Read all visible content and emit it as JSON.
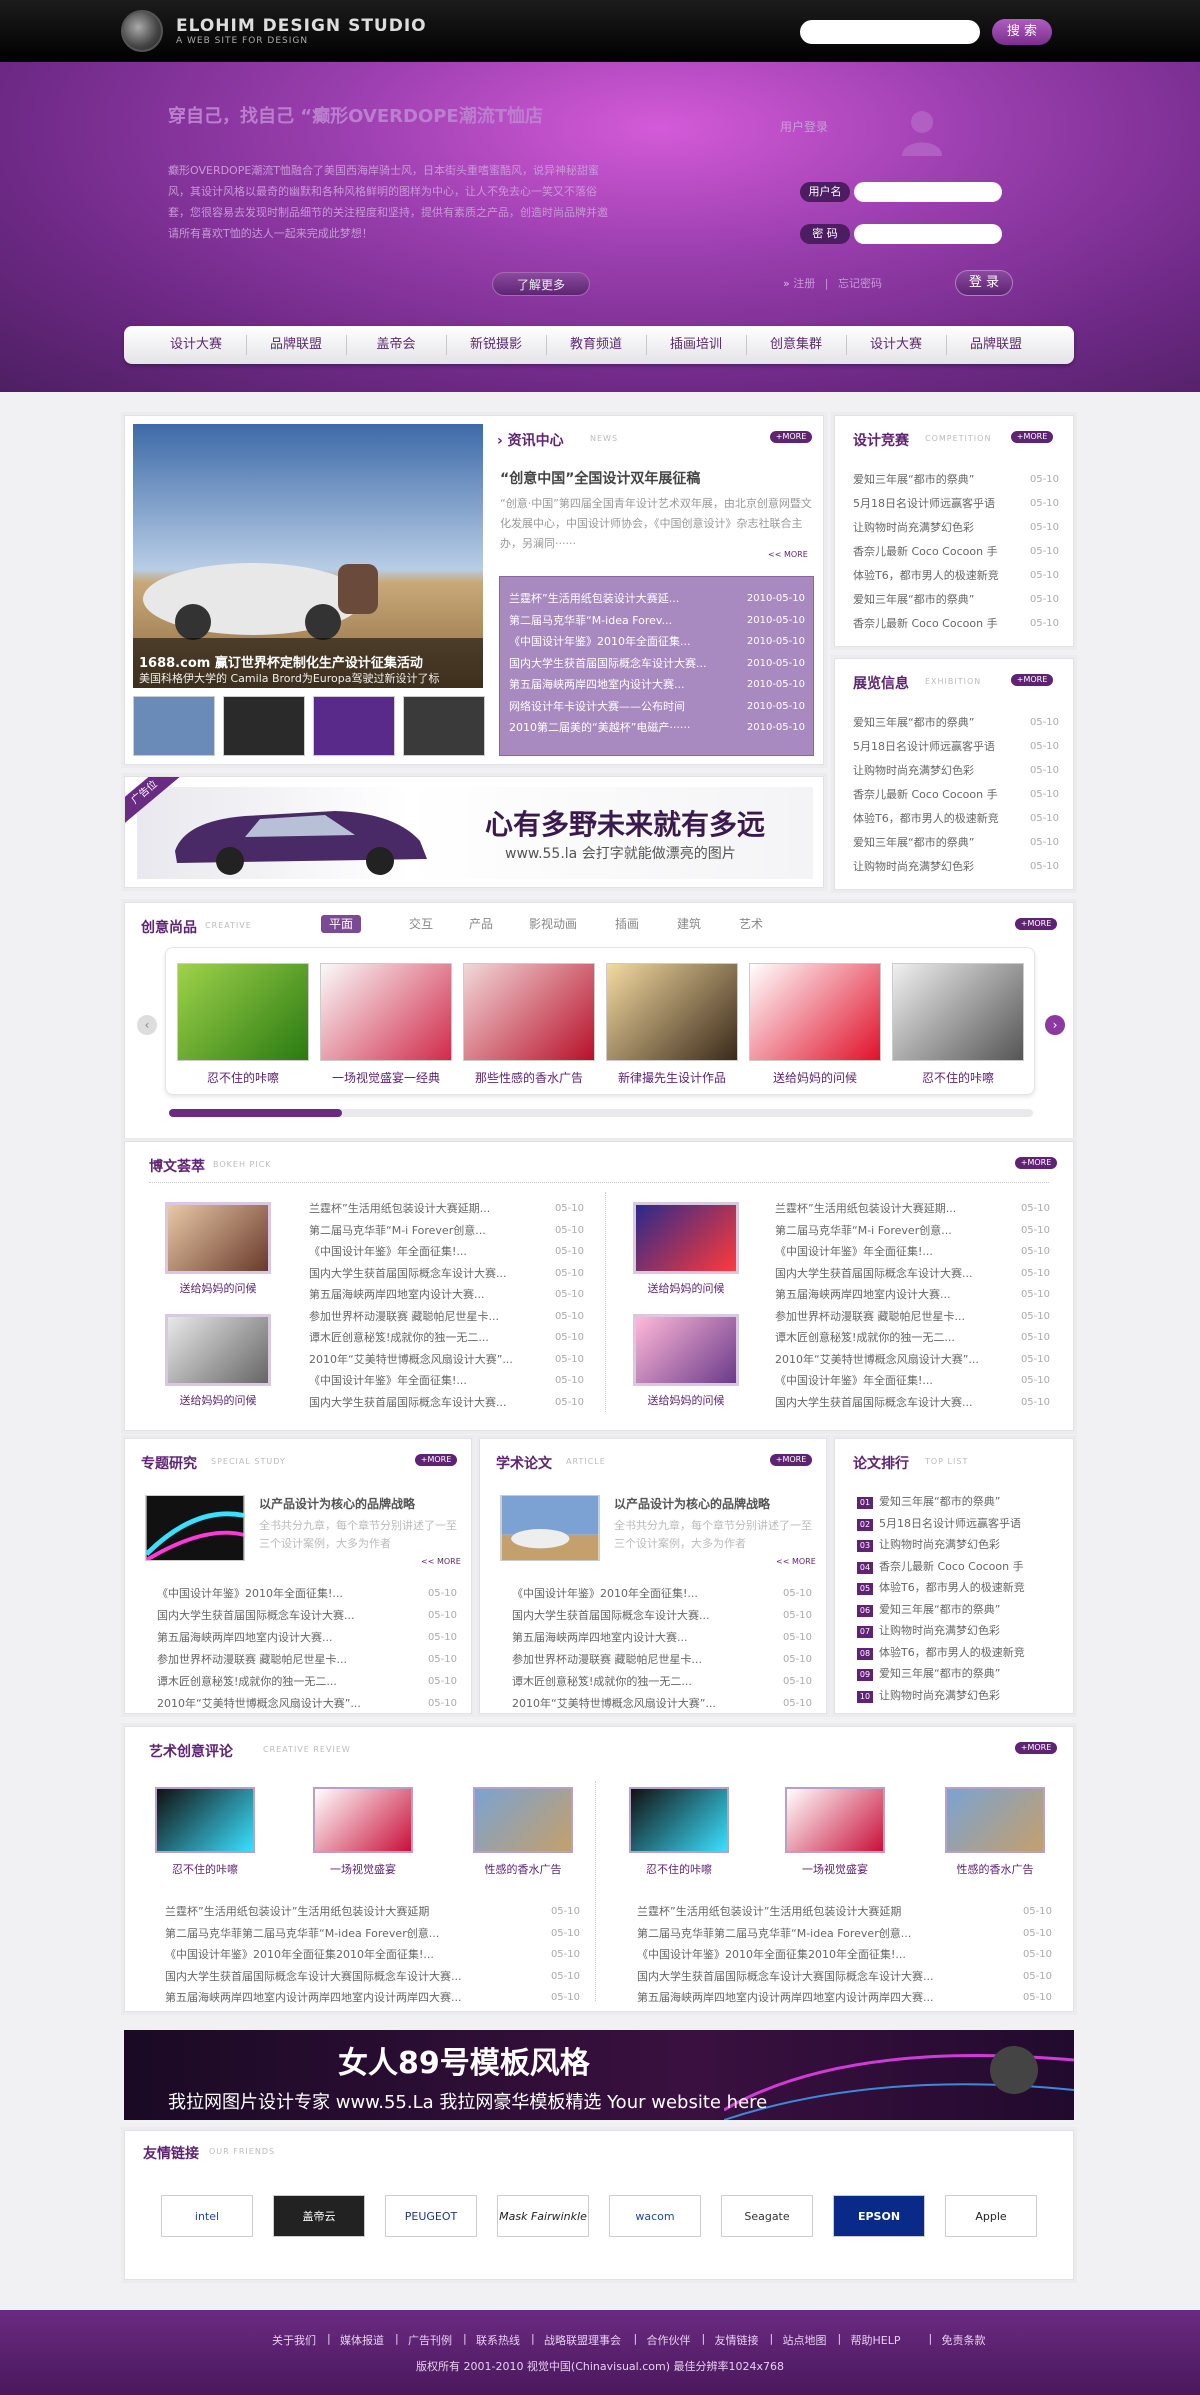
{
  "header": {
    "title": "ELOHIM DESIGN STUDIO",
    "subtitle": "A WEB SITE FOR DESIGN",
    "search_button": "搜 索"
  },
  "hero": {
    "title": "穿自己，找自己 “癫形OVERDOPE潮流T恤店",
    "desc": "癫形OVERDOPE潮流T恤融合了美国西海岸骑士风，日本街头重嗜蜜酷风，说异神秘甜蜜风，其设计风格以最奇的幽默和各种风格鲜明的图样为中心，让人不免去心一笑又不落俗套，您很容易去发现时制品细节的关注程度和坚持，提供有素质之产品，创造时尚品牌并邀请所有喜欢T恤的达人一起来完成此梦想！",
    "more": "了解更多"
  },
  "login": {
    "label": "用户登录",
    "username_tag": "用户名",
    "password_tag": "密  码",
    "register": "注册",
    "forgot": "忘记密码",
    "sep": "|",
    "button": "登 录"
  },
  "nav": [
    "设计大赛",
    "品牌联盟",
    "盖帝会",
    "新锐摄影",
    "教育频道",
    "插画培训",
    "创意集群",
    "设计大赛",
    "品牌联盟"
  ],
  "more_label": "+MORE",
  "news": {
    "title": "资讯中心",
    "sub": "NEWS",
    "headline": "“创意中国”全国设计双年展征稿",
    "summary": "“创意·中国”第四届全国青年设计艺术双年展，由北京创意网暨文化发展中心，中国设计师协会，《中国创意设计》杂志社联合主办，另澜同······",
    "summary_more": "<< MORE",
    "feature_caption1": "1688.com 赢订世界杯定制化生产设计征集活动",
    "feature_caption2": "美国科格伊大学的 Camila Brord为Europa驾驶过新设计了标",
    "items": [
      {
        "t": "兰霆杯”生活用纸包装设计大赛延...",
        "d": "2010-05-10"
      },
      {
        "t": "第二届马克华菲“M-idea Forev...",
        "d": "2010-05-10"
      },
      {
        "t": "《中国设计年鉴》2010年全面征集...",
        "d": "2010-05-10"
      },
      {
        "t": "国内大学生获首届国际概念车设计大赛...",
        "d": "2010-05-10"
      },
      {
        "t": "第五届海峡两岸四地室内设计大赛...",
        "d": "2010-05-10"
      },
      {
        "t": "网络设计年卡设计大赛——公布时间",
        "d": "2010-05-10"
      },
      {
        "t": "2010第二届美的“美越杯”电磁产······",
        "d": "2010-05-10"
      }
    ]
  },
  "contest": {
    "title": "设计竞赛",
    "sub": "COMPETITION",
    "items": [
      {
        "t": "爱知三年展“都市的祭典”",
        "d": "05-10"
      },
      {
        "t": "5月18日名设计师远赢客乎语",
        "d": "05-10"
      },
      {
        "t": "让购物时尚充满梦幻色彩",
        "d": "05-10"
      },
      {
        "t": "香奈儿最新 Coco Cocoon 手",
        "d": "05-10"
      },
      {
        "t": "体验T6，都市男人的极速新竞",
        "d": "05-10"
      },
      {
        "t": "爱知三年展“都市的祭典”",
        "d": "05-10"
      },
      {
        "t": "香奈儿最新 Coco Cocoon 手",
        "d": "05-10"
      }
    ]
  },
  "exhibit": {
    "title": "展览信息",
    "sub": "EXHIBITION",
    "items": [
      {
        "t": "爱知三年展“都市的祭典”",
        "d": "05-10"
      },
      {
        "t": "5月18日名设计师远赢客乎语",
        "d": "05-10"
      },
      {
        "t": "让购物时尚充满梦幻色彩",
        "d": "05-10"
      },
      {
        "t": "香奈儿最新 Coco Cocoon 手",
        "d": "05-10"
      },
      {
        "t": "体验T6，都市男人的极速新竞",
        "d": "05-10"
      },
      {
        "t": "爱知三年展“都市的祭典”",
        "d": "05-10"
      },
      {
        "t": "让购物时尚充满梦幻色彩",
        "d": "05-10"
      }
    ]
  },
  "ad1": {
    "tag": "广告位",
    "slogan": "心有多野未来就有多远",
    "sub": "www.55.la 会打字就能做漂亮的图片"
  },
  "creative": {
    "title": "创意尚品",
    "sub": "CREATIVE",
    "tabs": [
      "平面",
      "交互",
      "产品",
      "影视动画",
      "插画",
      "建筑",
      "艺术"
    ],
    "items": [
      "忍不住的咔嚓",
      "一场视觉盛宴一经典",
      "那些性感的香水广告",
      "新律撮先生设计作品",
      "送给妈妈的问候",
      "忍不住的咔嚓"
    ]
  },
  "blog": {
    "title": "博文荟萃",
    "sub": "BOKEH PICK",
    "caps": [
      "送给妈妈的问候",
      "送给妈妈的问候",
      "送给妈妈的问候",
      "送给妈妈的问候"
    ],
    "items": [
      {
        "t": "兰霆杯”生活用纸包装设计大赛延期...",
        "d": "05-10"
      },
      {
        "t": "第二届马克华菲“M-i Forever创意...",
        "d": "05-10"
      },
      {
        "t": "《中国设计年鉴》年全面征集!...",
        "d": "05-10"
      },
      {
        "t": "国内大学生获首届国际概念车设计大赛...",
        "d": "05-10"
      },
      {
        "t": "第五届海峡两岸四地室内设计大赛...",
        "d": "05-10"
      },
      {
        "t": "参加世界杯动漫联赛 藏聪帕尼世星卡...",
        "d": "05-10"
      },
      {
        "t": "谭木匠创意秘笈!成就你的独一无二...",
        "d": "05-10"
      },
      {
        "t": "2010年“艾美特世博概念风扇设计大赛”...",
        "d": "05-10"
      },
      {
        "t": "《中国设计年鉴》年全面征集!...",
        "d": "05-10"
      },
      {
        "t": "国内大学生获首届国际概念车设计大赛...",
        "d": "05-10"
      }
    ]
  },
  "special": {
    "title": "专题研究",
    "sub": "SPECIAL STUDY",
    "headline": "以产品设计为核心的品牌战略",
    "summary": "全书共分九章，每个章节分别讲述了一至三个设计案例，大多为作者",
    "more": "<< MORE",
    "items": [
      {
        "t": "《中国设计年鉴》2010年全面征集!...",
        "d": "05-10"
      },
      {
        "t": "国内大学生获首届国际概念车设计大赛...",
        "d": "05-10"
      },
      {
        "t": "第五届海峡两岸四地室内设计大赛...",
        "d": "05-10"
      },
      {
        "t": "参加世界杯动漫联赛 藏聪帕尼世星卡...",
        "d": "05-10"
      },
      {
        "t": "谭木匠创意秘笈!成就你的独一无二...",
        "d": "05-10"
      },
      {
        "t": "2010年“艾美特世博概念风扇设计大赛”...",
        "d": "05-10"
      }
    ]
  },
  "article": {
    "title": "学术论文",
    "sub": "ARTICLE",
    "headline": "以产品设计为核心的品牌战略",
    "summary": "全书共分九章，每个章节分别讲述了一至三个设计案例，大多为作者",
    "more": "<< MORE",
    "items": [
      {
        "t": "《中国设计年鉴》2010年全面征集!...",
        "d": "05-10"
      },
      {
        "t": "国内大学生获首届国际概念车设计大赛...",
        "d": "05-10"
      },
      {
        "t": "第五届海峡两岸四地室内设计大赛...",
        "d": "05-10"
      },
      {
        "t": "参加世界杯动漫联赛 藏聪帕尼世星卡...",
        "d": "05-10"
      },
      {
        "t": "谭木匠创意秘笈!成就你的独一无二...",
        "d": "05-10"
      },
      {
        "t": "2010年“艾美特世博概念风扇设计大赛”...",
        "d": "05-10"
      }
    ]
  },
  "rank": {
    "title": "论文排行",
    "sub": "TOP LIST",
    "items": [
      "爱知三年展“都市的祭典”",
      "5月18日名设计师远赢客乎语",
      "让购物时尚充满梦幻色彩",
      "香奈儿最新 Coco Cocoon 手",
      "体验T6，都市男人的极速新竞",
      "爱知三年展“都市的祭典”",
      "让购物时尚充满梦幻色彩",
      "体验T6，都市男人的极速新竞",
      "爱知三年展“都市的祭典”",
      "让购物时尚充满梦幻色彩"
    ],
    "nums": [
      "01",
      "02",
      "03",
      "04",
      "05",
      "06",
      "07",
      "08",
      "09",
      "10"
    ]
  },
  "review": {
    "title": "艺术创意评论",
    "sub": "CREATIVE REVIEW",
    "caps": [
      "忍不住的咔嚓",
      "一场视觉盛宴",
      "性感的香水广告",
      "忍不住的咔嚓",
      "一场视觉盛宴",
      "性感的香水广告"
    ],
    "items": [
      {
        "t": "兰霆杯”生活用纸包装设计”生活用纸包装设计大赛延期",
        "d": "05-10"
      },
      {
        "t": "第二届马克华菲第二届马克华菲“M-idea Forever创意...",
        "d": "05-10"
      },
      {
        "t": "《中国设计年鉴》2010年全面征集2010年全面征集!...",
        "d": "05-10"
      },
      {
        "t": "国内大学生获首届国际概念车设计大赛国际概念车设计大赛...",
        "d": "05-10"
      },
      {
        "t": "第五届海峡两岸四地室内设计两岸四地室内设计两岸四大赛...",
        "d": "05-10"
      }
    ]
  },
  "ad2": {
    "title": "女人89号模板风格",
    "sub": "我拉网图片设计专家 www.55.La 我拉网豪华模板精选 Your website here"
  },
  "friends": {
    "title": "友情链接",
    "sub": "OUR FRIENDS",
    "logos": [
      "intel",
      "盖帝云",
      "PEUGEOT",
      "Mask Fairwinkle",
      "wacom",
      "Seagate",
      "EPSON",
      "Apple"
    ]
  },
  "footer": {
    "links": [
      "关于我们",
      "媒体报道",
      "广告刊例",
      "联系热线",
      "战略联盟理事会",
      "合作伙伴",
      "友情链接",
      "站点地图",
      "帮助HELP",
      "免责条款"
    ],
    "copyright": "版权所有 2001-2010 视觉中国(Chinavisual.com) 最佳分辨率1024x768"
  }
}
